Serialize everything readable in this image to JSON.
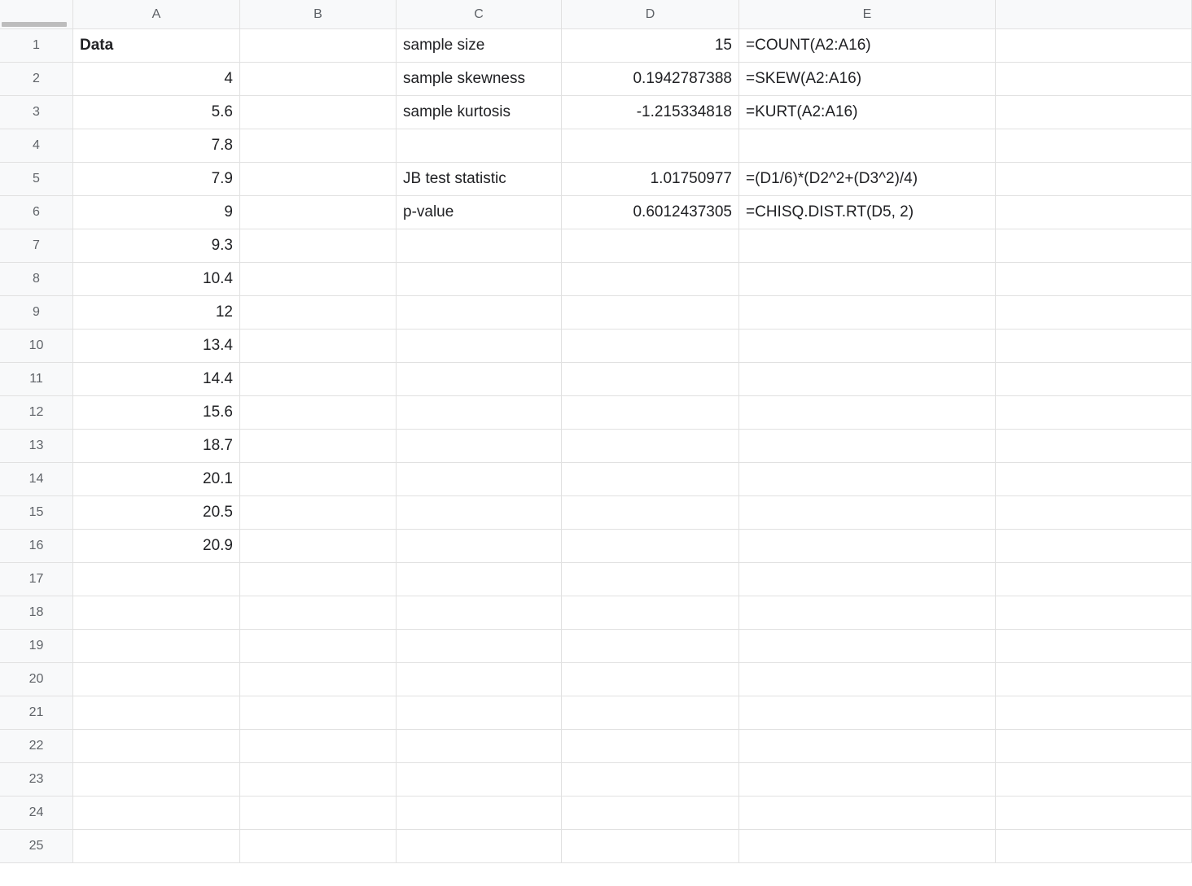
{
  "columns": [
    "A",
    "B",
    "C",
    "D",
    "E"
  ],
  "rowCount": 25,
  "cells": {
    "A1": {
      "value": "Data",
      "align": "left",
      "bold": true
    },
    "A2": {
      "value": "4",
      "align": "right"
    },
    "A3": {
      "value": "5.6",
      "align": "right"
    },
    "A4": {
      "value": "7.8",
      "align": "right"
    },
    "A5": {
      "value": "7.9",
      "align": "right"
    },
    "A6": {
      "value": "9",
      "align": "right"
    },
    "A7": {
      "value": "9.3",
      "align": "right"
    },
    "A8": {
      "value": "10.4",
      "align": "right"
    },
    "A9": {
      "value": "12",
      "align": "right"
    },
    "A10": {
      "value": "13.4",
      "align": "right"
    },
    "A11": {
      "value": "14.4",
      "align": "right"
    },
    "A12": {
      "value": "15.6",
      "align": "right"
    },
    "A13": {
      "value": "18.7",
      "align": "right"
    },
    "A14": {
      "value": "20.1",
      "align": "right"
    },
    "A15": {
      "value": "20.5",
      "align": "right"
    },
    "A16": {
      "value": "20.9",
      "align": "right"
    },
    "C1": {
      "value": "sample size",
      "align": "left"
    },
    "C2": {
      "value": "sample skewness",
      "align": "left"
    },
    "C3": {
      "value": "sample kurtosis",
      "align": "left"
    },
    "C5": {
      "value": "JB test statistic",
      "align": "left"
    },
    "C6": {
      "value": "p-value",
      "align": "left"
    },
    "D1": {
      "value": "15",
      "align": "right"
    },
    "D2": {
      "value": "0.1942787388",
      "align": "right"
    },
    "D3": {
      "value": "-1.215334818",
      "align": "right"
    },
    "D5": {
      "value": "1.01750977",
      "align": "right"
    },
    "D6": {
      "value": "0.6012437305",
      "align": "right"
    },
    "E1": {
      "value": "=COUNT(A2:A16)",
      "align": "left"
    },
    "E2": {
      "value": "=SKEW(A2:A16)",
      "align": "left"
    },
    "E3": {
      "value": "=KURT(A2:A16)",
      "align": "left"
    },
    "E5": {
      "value": "=(D1/6)*(D2^2+(D3^2)/4)",
      "align": "left"
    },
    "E6": {
      "value": "=CHISQ.DIST.RT(D5, 2)",
      "align": "left"
    }
  }
}
